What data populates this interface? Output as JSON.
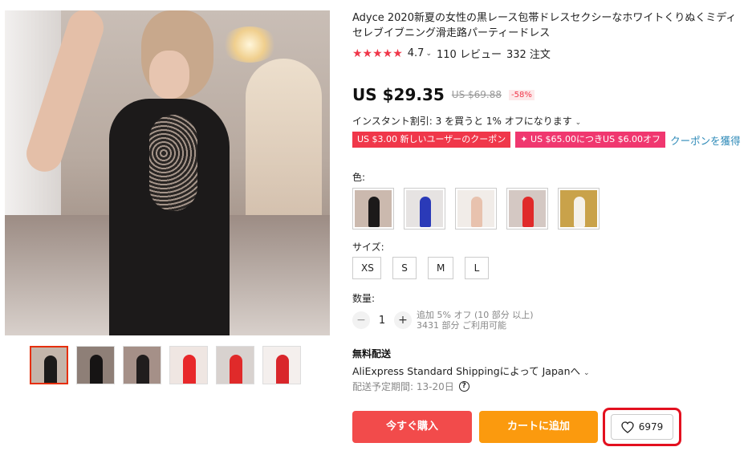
{
  "product": {
    "title": "Adyce 2020新夏の女性の黒レース包帯ドレスセクシーなホワイトくりぬくミディセレブイブニング滑走路パーティードレス",
    "stars": "★★★★★",
    "rating": "4.7",
    "reviews": "110 レビュー",
    "orders": "332 注文"
  },
  "pricing": {
    "price": "US $29.35",
    "original_price": "US $69.88",
    "discount": "-58%",
    "instant_discount": "インスタント割引: 3 を買うと 1% オフになります",
    "coupons": [
      "US $3.00 新しいユーザーのクーポン",
      "US $65.00につきUS $6.00オフ"
    ],
    "coupon_link": "クーポンを獲得"
  },
  "options": {
    "color_label": "色:",
    "size_label": "サイズ:",
    "sizes": [
      "XS",
      "S",
      "M",
      "L"
    ],
    "quantity_label": "数量:",
    "quantity": "1",
    "quantity_note_1": "追加 5% オフ (10 部分 以上)",
    "quantity_note_2": "3431 部分 ご利用可能"
  },
  "shipping": {
    "title": "無料配送",
    "method": "AliExpress Standard Shippingによって Japanへ",
    "date": "配送予定期間: 13-20日"
  },
  "actions": {
    "buy_now": "今すぐ購入",
    "add_to_cart": "カートに追加",
    "wishlist_count": "6979"
  },
  "icons": {
    "heart": "heart-icon",
    "help": "help-icon",
    "chevron": "chevron-down-icon"
  },
  "colors": {
    "accent": "#f24b4b",
    "cart": "#fb9a0e",
    "highlight": "#e3101f",
    "link": "#2e8ab8"
  }
}
